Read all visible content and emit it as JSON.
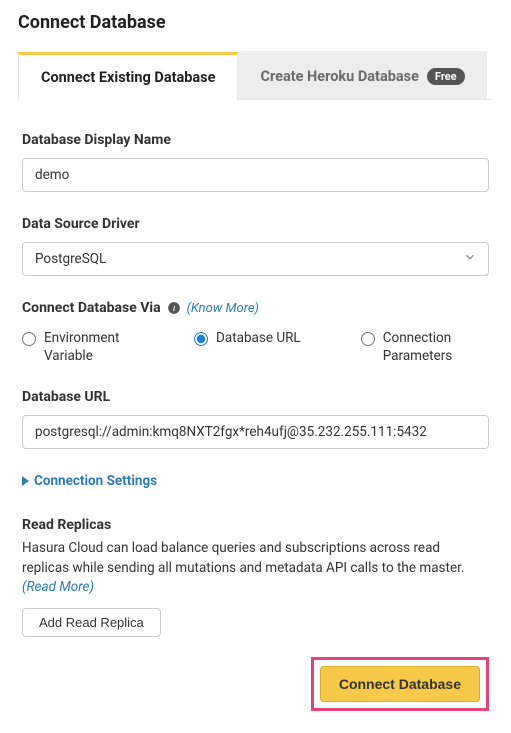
{
  "page": {
    "title": "Connect Database"
  },
  "tabs": {
    "existing": "Connect Existing Database",
    "heroku": "Create Heroku Database",
    "badge": "Free"
  },
  "fields": {
    "display_name_label": "Database Display Name",
    "display_name_value": "demo",
    "driver_label": "Data Source Driver",
    "driver_value": "PostgreSQL",
    "via_label": "Connect Database Via",
    "know_more": "(Know More)",
    "url_label": "Database URL",
    "url_value": "postgresql://admin:kmq8NXT2fgx*reh4ufj@35.232.255.111:5432"
  },
  "radios": {
    "env": "Environment Variable",
    "url": "Database URL",
    "params": "Connection Parameters"
  },
  "collapsible": {
    "connection_settings": "Connection Settings"
  },
  "replicas": {
    "title": "Read Replicas",
    "desc": "Hasura Cloud can load balance queries and subscriptions across read replicas while sending all mutations and metadata API calls to the master. ",
    "read_more": "(Read More)",
    "add_button": "Add Read Replica"
  },
  "footer": {
    "connect_button": "Connect Database"
  }
}
